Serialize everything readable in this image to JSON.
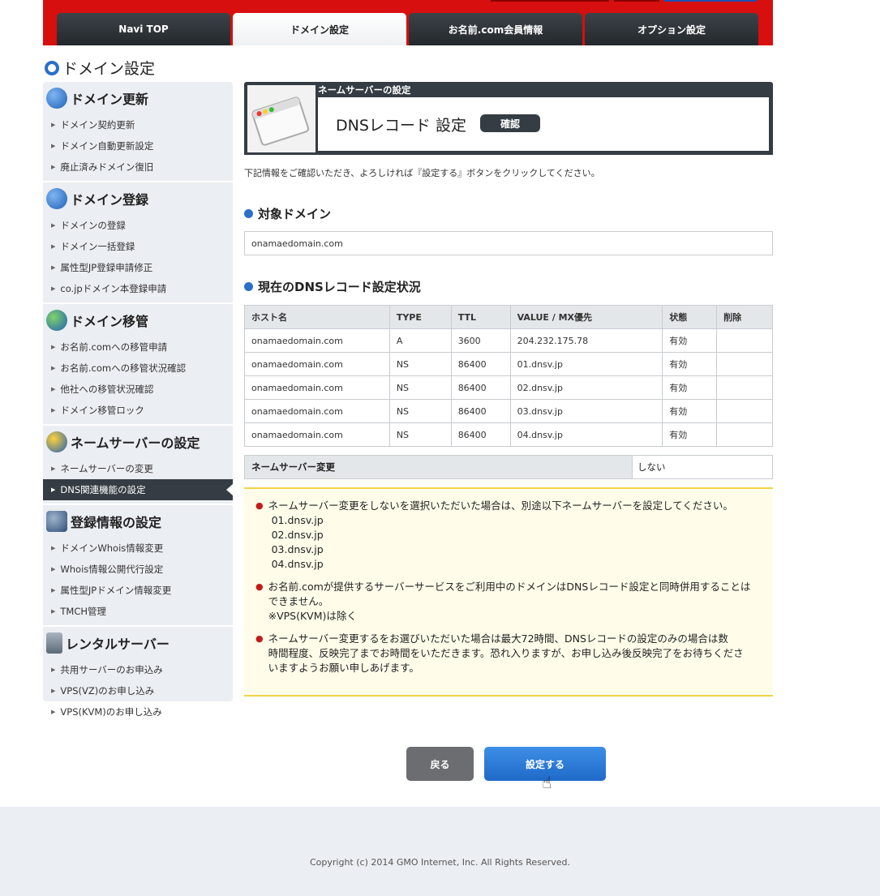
{
  "nav": {
    "tabs": [
      {
        "label": "Navi TOP",
        "active": false
      },
      {
        "label": "ドメイン設定",
        "active": true
      },
      {
        "label": "お名前.com会員情報",
        "active": false
      },
      {
        "label": "オプション設定",
        "active": false
      }
    ]
  },
  "page_title": "ドメイン設定",
  "sidebar": {
    "sections": [
      {
        "title": "ドメイン更新",
        "icon": "refresh-icon",
        "items": [
          "ドメイン契約更新",
          "ドメイン自動更新設定",
          "廃止済みドメイン復旧"
        ]
      },
      {
        "title": "ドメイン登録",
        "icon": "plus-icon",
        "items": [
          "ドメインの登録",
          "ドメイン一括登録",
          "属性型JP登録申請修正",
          "co.jpドメイン本登録申請"
        ]
      },
      {
        "title": "ドメイン移管",
        "icon": "transfer-icon",
        "items": [
          "お名前.comへの移管申請",
          "お名前.comへの移管状況確認",
          "他社への移管状況確認",
          "ドメイン移管ロック"
        ]
      },
      {
        "title": "ネームサーバーの設定",
        "icon": "nameserver-icon",
        "items": [
          "ネームサーバーの変更",
          "DNS関連機能の設定"
        ],
        "active_item": 1
      },
      {
        "title": "登録情報の設定",
        "icon": "database-icon",
        "items": [
          "ドメインWhois情報変更",
          "Whois情報公開代行設定",
          "属性型JPドメイン情報変更",
          "TMCH管理"
        ]
      },
      {
        "title": "レンタルサーバー",
        "icon": "server-icon",
        "items": [
          "共用サーバーのお申込み",
          "VPS(VZ)のお申し込み",
          "VPS(KVM)のお申し込み"
        ]
      }
    ]
  },
  "header_box": {
    "caption": "ネームサーバーの設定",
    "title": "DNSレコード 設定",
    "badge": "確認"
  },
  "intro": "下記情報をご確認いただき、よろしければ『設定する』ボタンをクリックしてください。",
  "target": {
    "title": "対象ドメイン",
    "domain": "onamaedomain.com"
  },
  "records": {
    "title": "現在のDNSレコード設定状況",
    "columns": [
      "ホスト名",
      "TYPE",
      "TTL",
      "VALUE / MX優先",
      "状態",
      "削除"
    ],
    "rows": [
      [
        "onamaedomain.com",
        "A",
        "3600",
        "204.232.175.78",
        "有効",
        ""
      ],
      [
        "onamaedomain.com",
        "NS",
        "86400",
        "01.dnsv.jp",
        "有効",
        ""
      ],
      [
        "onamaedomain.com",
        "NS",
        "86400",
        "02.dnsv.jp",
        "有効",
        ""
      ],
      [
        "onamaedomain.com",
        "NS",
        "86400",
        "03.dnsv.jp",
        "有効",
        ""
      ],
      [
        "onamaedomain.com",
        "NS",
        "86400",
        "04.dnsv.jp",
        "有効",
        ""
      ]
    ]
  },
  "ns_change": {
    "label": "ネームサーバー変更",
    "value": "しない"
  },
  "notes": [
    [
      "ネームサーバー変更をしないを選択いただいた場合は、別途以下ネームサーバーを設定してください。",
      " 01.dnsv.jp",
      " 02.dnsv.jp",
      " 03.dnsv.jp",
      " 04.dnsv.jp"
    ],
    [
      "お名前.comが提供するサーバーサービスをご利用中のドメインはDNSレコード設定と同時併用することは",
      "できません。",
      "※VPS(KVM)は除く"
    ],
    [
      "ネームサーバー変更するをお選びいただいた場合は最大72時間、DNSレコードの設定のみの場合は数",
      "時間程度、反映完了までお時間をいただきます。恐れ入りますが、お申し込み後反映完了をお待ちくださ",
      "いますようお願い申しあげます。"
    ]
  ],
  "buttons": {
    "back": "戻る",
    "submit": "設定する"
  },
  "footer": {
    "copyright": "Copyright (c) 2014 GMO Internet, Inc. All Rights Reserved."
  }
}
